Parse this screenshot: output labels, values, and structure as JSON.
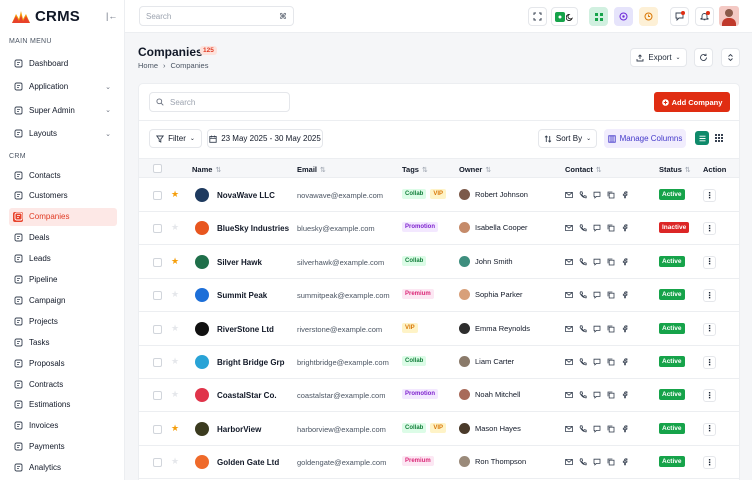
{
  "app": {
    "name": "CRMS"
  },
  "sidebar": {
    "main_menu_label": "MAIN MENU",
    "crm_label": "CRM",
    "main_items": [
      {
        "label": "Dashboard",
        "icon": "dashboard-icon",
        "chevron": false
      },
      {
        "label": "Application",
        "icon": "application-icon",
        "chevron": true
      },
      {
        "label": "Super Admin",
        "icon": "user-shield-icon",
        "chevron": true
      },
      {
        "label": "Layouts",
        "icon": "layout-icon",
        "chevron": true
      }
    ],
    "crm_items": [
      {
        "label": "Contacts",
        "icon": "contacts-icon"
      },
      {
        "label": "Customers",
        "icon": "customers-icon"
      },
      {
        "label": "Companies",
        "icon": "building-icon",
        "active": true
      },
      {
        "label": "Deals",
        "icon": "deals-icon"
      },
      {
        "label": "Leads",
        "icon": "leads-icon"
      },
      {
        "label": "Pipeline",
        "icon": "pipeline-icon"
      },
      {
        "label": "Campaign",
        "icon": "campaign-icon"
      },
      {
        "label": "Projects",
        "icon": "projects-icon"
      },
      {
        "label": "Tasks",
        "icon": "tasks-icon"
      },
      {
        "label": "Proposals",
        "icon": "proposals-icon"
      },
      {
        "label": "Contracts",
        "icon": "contracts-icon"
      },
      {
        "label": "Estimations",
        "icon": "estimations-icon"
      },
      {
        "label": "Invoices",
        "icon": "invoices-icon"
      },
      {
        "label": "Payments",
        "icon": "payments-icon"
      },
      {
        "label": "Analytics",
        "icon": "analytics-icon"
      }
    ]
  },
  "topbar": {
    "search_placeholder": "Search",
    "shortcut": "⌘"
  },
  "page": {
    "title": "Companies",
    "count": "125",
    "breadcrumb": [
      "Home",
      "Companies"
    ],
    "export_label": "Export"
  },
  "toolbar": {
    "search_placeholder": "Search",
    "add_label": "Add Company",
    "filter_label": "Filter",
    "date_range": "23 May 2025 - 30 May 2025",
    "sort_label": "Sort By",
    "manage_columns_label": "Manage Columns"
  },
  "table": {
    "columns": [
      "Name",
      "Email",
      "Tags",
      "Owner",
      "Contact",
      "Status",
      "Action"
    ],
    "rows": [
      {
        "name": "NovaWave LLC",
        "email": "novawave@example.com",
        "tags": [
          "Collab",
          "VIP"
        ],
        "owner": "Robert Johnson",
        "status": "Active",
        "starred": true,
        "logo_color": "#1e3a5f",
        "avatar_color": "#7c5a4a"
      },
      {
        "name": "BlueSky Industries",
        "email": "bluesky@example.com",
        "tags": [
          "Promotion"
        ],
        "owner": "Isabella Cooper",
        "status": "Inactive",
        "starred": false,
        "logo_color": "#e8561f",
        "avatar_color": "#c58b6a"
      },
      {
        "name": "Silver Hawk",
        "email": "silverhawk@example.com",
        "tags": [
          "Collab"
        ],
        "owner": "John Smith",
        "status": "Active",
        "starred": true,
        "logo_color": "#1f6f4a",
        "avatar_color": "#3e8e7e"
      },
      {
        "name": "Summit  Peak",
        "email": "summitpeak@example.com",
        "tags": [
          "Premium"
        ],
        "owner": "Sophia Parker",
        "status": "Active",
        "starred": false,
        "logo_color": "#1d6fd8",
        "avatar_color": "#d8a07a"
      },
      {
        "name": "RiverStone Ltd",
        "email": "riverstone@example.com",
        "tags": [
          "VIP"
        ],
        "owner": "Emma Reynolds",
        "status": "Active",
        "starred": false,
        "logo_color": "#111111",
        "avatar_color": "#2d2d2d"
      },
      {
        "name": "Bright Bridge Grp",
        "email": "brightbridge@example.com",
        "tags": [
          "Collab"
        ],
        "owner": "Liam Carter",
        "status": "Active",
        "starred": false,
        "logo_color": "#29a3d6",
        "avatar_color": "#8a7a6a"
      },
      {
        "name": "CoastalStar Co.",
        "email": "coastalstar@example.com",
        "tags": [
          "Promotion"
        ],
        "owner": "Noah Mitchell",
        "status": "Active",
        "starred": false,
        "logo_color": "#e0344a",
        "avatar_color": "#a86a5a"
      },
      {
        "name": "HarborView",
        "email": "harborview@example.com",
        "tags": [
          "Collab",
          "VIP"
        ],
        "owner": "Mason Hayes",
        "status": "Active",
        "starred": true,
        "logo_color": "#3b3b1f",
        "avatar_color": "#4a3a2a"
      },
      {
        "name": "Golden Gate Ltd",
        "email": "goldengate@example.com",
        "tags": [
          "Premium"
        ],
        "owner": "Ron Thompson",
        "status": "Active",
        "starred": false,
        "logo_color": "#ef6a2a",
        "avatar_color": "#9a8a7a"
      }
    ]
  },
  "colors": {
    "accent": "#e02d12",
    "active_status": "#16a34a",
    "inactive_status": "#dc2626",
    "tag_collab_bg": "#dcfce7",
    "tag_collab_fg": "#15803d",
    "tag_vip_bg": "#fef3c7",
    "tag_vip_fg": "#d97706",
    "tag_promotion_bg": "#f3e8ff",
    "tag_promotion_fg": "#7e22ce",
    "tag_premium_bg": "#fce7f3",
    "tag_premium_fg": "#db2777"
  }
}
